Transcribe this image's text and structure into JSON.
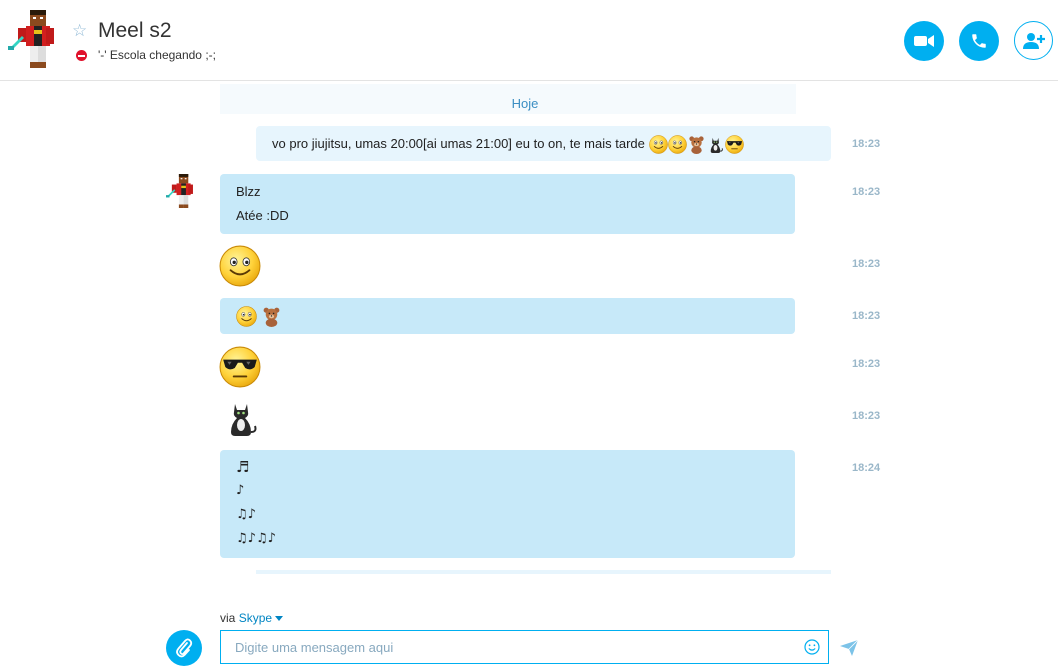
{
  "header": {
    "contact_name": "Meel s2",
    "mood_message": "'-' Escola chegando ;-;",
    "favorite_icon": "star-outline",
    "status_icon": "do-not-disturb",
    "buttons": [
      "video-call-icon",
      "audio-call-icon",
      "add-contact-icon"
    ]
  },
  "conversation": {
    "date_separator": "Hoje",
    "messages": [
      {
        "direction": "out",
        "text": "vo pro jiujitsu, umas  20:00[ai umas 21:00] eu to on, te mais tarde",
        "emoticons": [
          "smile-icon",
          "smile-icon",
          "bear-icon",
          "cat-icon",
          "cool-icon"
        ],
        "time": "18:23"
      },
      {
        "direction": "in",
        "lines": [
          "Blzz",
          "Atée :DD"
        ],
        "time": "18:23"
      },
      {
        "direction": "in",
        "emoticon": "smile-icon",
        "time": "18:23"
      },
      {
        "direction": "in",
        "emoticons": [
          "smile-icon",
          "bear-icon"
        ],
        "time": "18:23"
      },
      {
        "direction": "in",
        "emoticon": "cool-icon",
        "time": "18:23"
      },
      {
        "direction": "in",
        "emoticon": "cat-icon",
        "time": "18:23"
      },
      {
        "direction": "in",
        "lines": [
          "♬",
          "♪",
          "♫♪",
          "♫♪♫♪"
        ],
        "time": "18:24"
      }
    ]
  },
  "compose": {
    "via_label": "via",
    "via_service": "Skype",
    "placeholder": "Digite uma mensagem aqui"
  },
  "colors": {
    "accent": "#00aff0",
    "incoming_bubble": "#c7e9f9",
    "outgoing_bubble": "#e7f5fd",
    "timestamp": "#9ab7c9",
    "link": "#0085c3",
    "status_dnd": "#e0112b"
  }
}
